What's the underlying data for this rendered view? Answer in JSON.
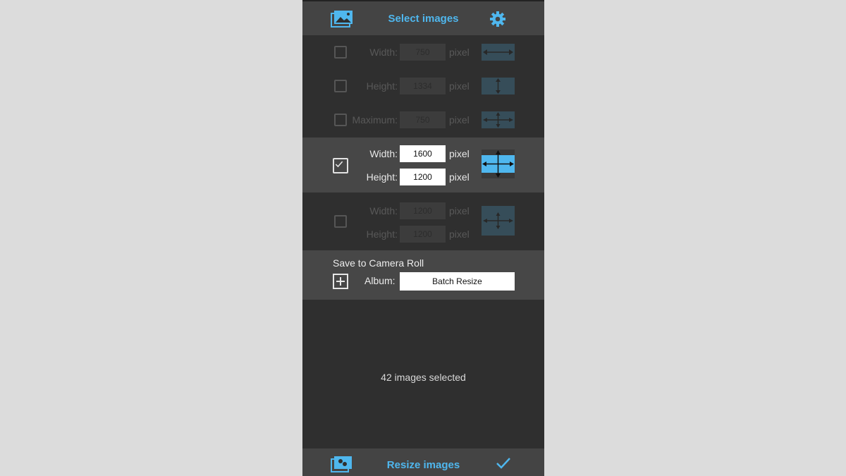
{
  "header": {
    "title": "Select images",
    "left_icon": "photo-library-icon",
    "right_icon": "gear-icon"
  },
  "options": [
    {
      "checked": false,
      "enabled": false,
      "fields": [
        {
          "label": "Width:",
          "value": "750",
          "unit": "pixel"
        }
      ],
      "icon": "width-arrows-icon"
    },
    {
      "checked": false,
      "enabled": false,
      "fields": [
        {
          "label": "Height:",
          "value": "1334",
          "unit": "pixel"
        }
      ],
      "icon": "height-arrows-icon"
    },
    {
      "checked": false,
      "enabled": false,
      "fields": [
        {
          "label": "Maximum:",
          "value": "750",
          "unit": "pixel"
        }
      ],
      "icon": "maximum-arrows-icon"
    },
    {
      "checked": true,
      "enabled": true,
      "fields": [
        {
          "label": "Width:",
          "value": "1600",
          "unit": "pixel"
        },
        {
          "label": "Height:",
          "value": "1200",
          "unit": "pixel"
        }
      ],
      "icon": "stretch-arrows-icon"
    },
    {
      "checked": false,
      "enabled": false,
      "fields": [
        {
          "label": "Width:",
          "value": "1200",
          "unit": "pixel"
        },
        {
          "label": "Height:",
          "value": "1200",
          "unit": "pixel"
        }
      ],
      "icon": "fit-arrows-icon"
    }
  ],
  "save": {
    "title": "Save to Camera Roll",
    "album_label": "Album:",
    "album_value": "Batch Resize"
  },
  "status": "42 images selected",
  "footer": {
    "title": "Resize images",
    "left_icon": "resize-images-icon",
    "right_icon": "checkmark-icon"
  },
  "colors": {
    "accent": "#4fb7ee",
    "background": "#2f2f2f",
    "bar": "#444444",
    "page": "#dcdcdc"
  }
}
